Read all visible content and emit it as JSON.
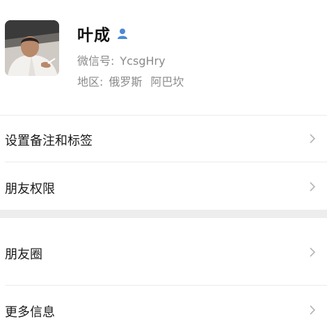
{
  "profile": {
    "name": "叶成",
    "wechat_id_label": "微信号:",
    "wechat_id": "YcsgHry",
    "region_label": "地区:",
    "region_country": "俄罗斯",
    "region_city": "阿巴坎",
    "gender_icon": "male-person-icon",
    "accent_color": "#4a8ad6"
  },
  "menu_group_1": [
    {
      "label": "设置备注和标签"
    },
    {
      "label": "朋友权限"
    }
  ],
  "menu_group_2": [
    {
      "label": "朋友圈"
    },
    {
      "label": "更多信息"
    }
  ]
}
